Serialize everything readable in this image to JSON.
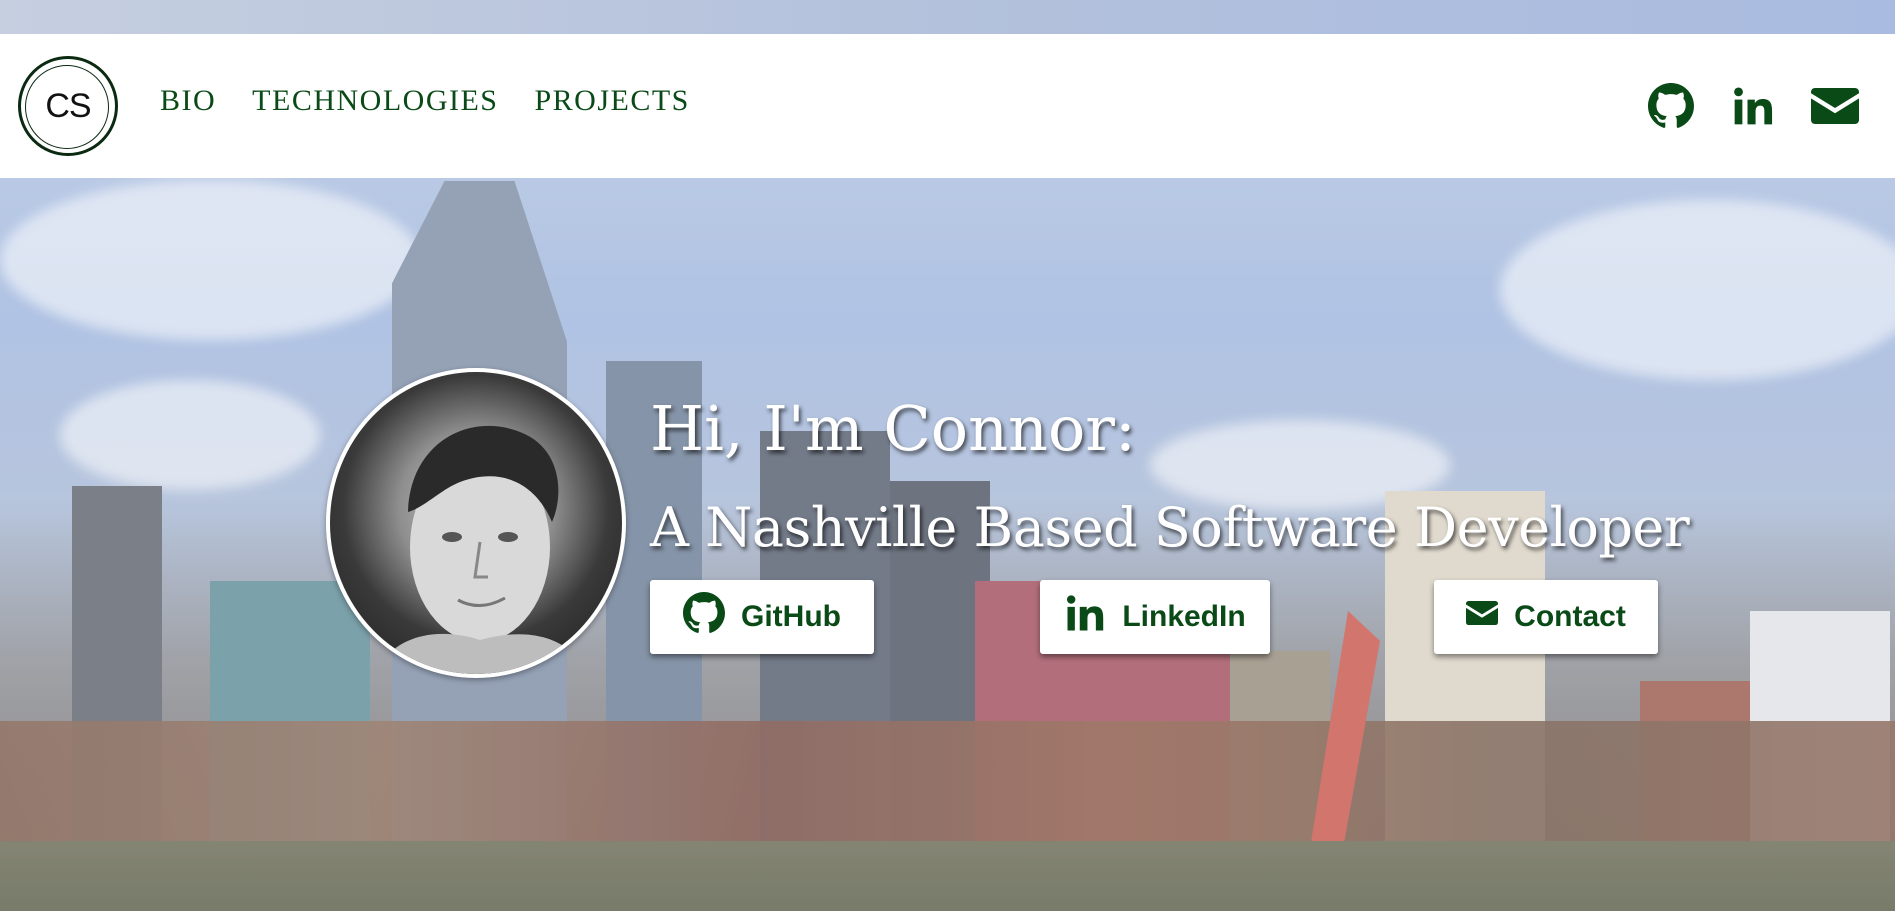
{
  "header": {
    "logo_text": "CS",
    "nav": [
      {
        "label": "BIO"
      },
      {
        "label": "TECHNOLOGIES"
      },
      {
        "label": "PROJECTS"
      }
    ],
    "social_icons": [
      "github-icon",
      "linkedin-icon",
      "envelope-icon"
    ]
  },
  "hero": {
    "title": "Hi, I'm Connor:",
    "subtitle": "A Nashville Based Software Developer",
    "buttons": [
      {
        "label": "GitHub",
        "icon": "github-icon"
      },
      {
        "label": "LinkedIn",
        "icon": "linkedin-icon"
      },
      {
        "label": "Contact",
        "icon": "envelope-icon"
      }
    ]
  },
  "colors": {
    "accent": "#0a4a17",
    "nav_bg": "#ffffff",
    "hero_text": "#ffffff"
  }
}
